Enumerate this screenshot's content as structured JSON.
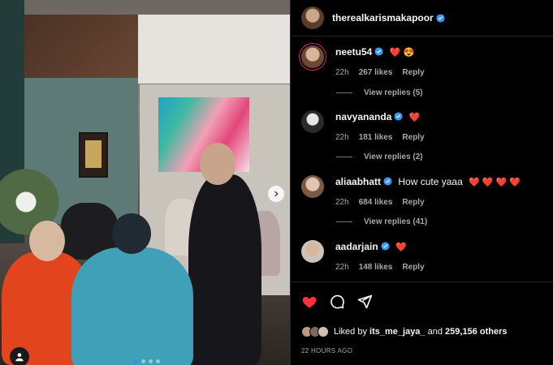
{
  "post": {
    "author": "therealkarismakapoor",
    "verified": true
  },
  "media": {
    "carousel_dots": 4,
    "active_dot": 0
  },
  "comments": [
    {
      "username": "neetu54",
      "text": "",
      "emojis": "❤️ 😍",
      "time": "22h",
      "likes": "267 likes",
      "reply": "Reply",
      "view_replies": "View replies (5)"
    },
    {
      "username": "navyananda",
      "text": "",
      "emojis": "❤️",
      "time": "22h",
      "likes": "181 likes",
      "reply": "Reply",
      "view_replies": "View replies (2)"
    },
    {
      "username": "aliaabhatt",
      "text": "How cute yaaa",
      "emojis": "❤️ ❤️ ❤️ ❤️",
      "time": "22h",
      "likes": "684 likes",
      "reply": "Reply",
      "view_replies": "View replies (41)"
    },
    {
      "username": "aadarjain",
      "text": "",
      "emojis": "❤️",
      "time": "22h",
      "likes": "148 likes",
      "reply": "Reply",
      "view_replies": ""
    }
  ],
  "actions": {
    "liked_by_prefix": "Liked by",
    "liked_by_user": "its_me_jaya_",
    "liked_by_middle": "and",
    "liked_by_count": "259,156 others",
    "timestamp": "22 HOURS AGO"
  },
  "colors": {
    "like_red": "#ff3040",
    "verified_blue": "#3897f0",
    "muted": "#a8a8a8"
  }
}
